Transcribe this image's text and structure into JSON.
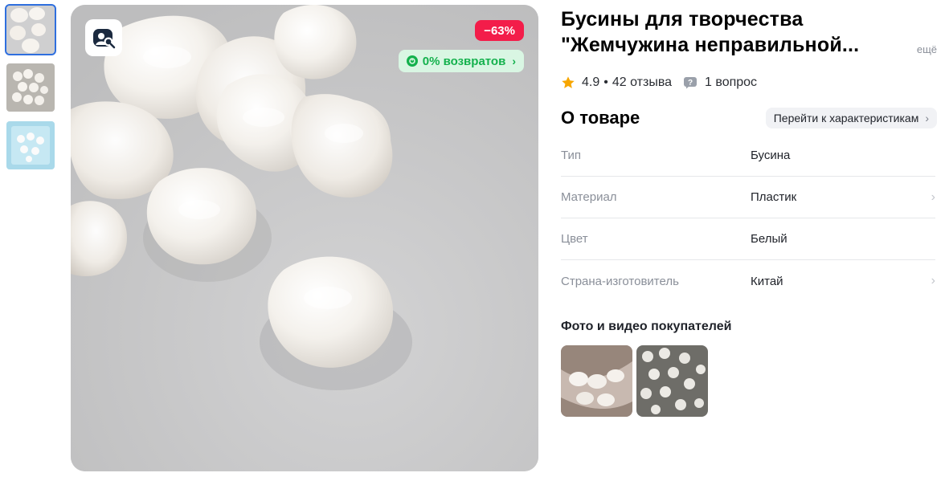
{
  "product": {
    "title_line1": "Бусины для творчества",
    "title_line2": "\"Жемчужина неправильной...",
    "more_label": "ещё",
    "rating": "4.9",
    "rating_sep": "•",
    "reviews_label": "42 отзыва",
    "questions_label": "1 вопрос"
  },
  "gallery": {
    "thumbnails": [
      "pearls-closeup",
      "pearls-scattered",
      "pearls-package"
    ],
    "active_index": 0,
    "discount_label": "−63%",
    "returns_label": "0% возвратов",
    "returns_chevron": "›"
  },
  "about": {
    "title": "О товаре",
    "to_specs_label": "Перейти к характеристикам",
    "to_specs_chevron": "›",
    "specs": [
      {
        "key": "Тип",
        "value": "Бусина",
        "has_chevron": false
      },
      {
        "key": "Материал",
        "value": "Пластик",
        "has_chevron": true
      },
      {
        "key": "Цвет",
        "value": "Белый",
        "has_chevron": false
      },
      {
        "key": "Страна-изготовитель",
        "value": "Китай",
        "has_chevron": true
      }
    ],
    "spec_chevron": "›"
  },
  "ugc": {
    "title": "Фото и видео покупателей",
    "items": [
      "bracelet-photo",
      "pearls-photo"
    ]
  },
  "colors": {
    "discount_bg": "#f31d4a",
    "returns_bg": "#d9f6e3",
    "returns_text": "#14b14d",
    "star": "#f7a600",
    "active_thumb_outline": "#2f6fde",
    "muted_text": "#8a8f99"
  },
  "icons": {
    "star": "star-icon",
    "question": "question-icon",
    "photo_search": "photo-search-icon",
    "returns": "returns-icon",
    "chevron": "chevron-right-icon"
  }
}
